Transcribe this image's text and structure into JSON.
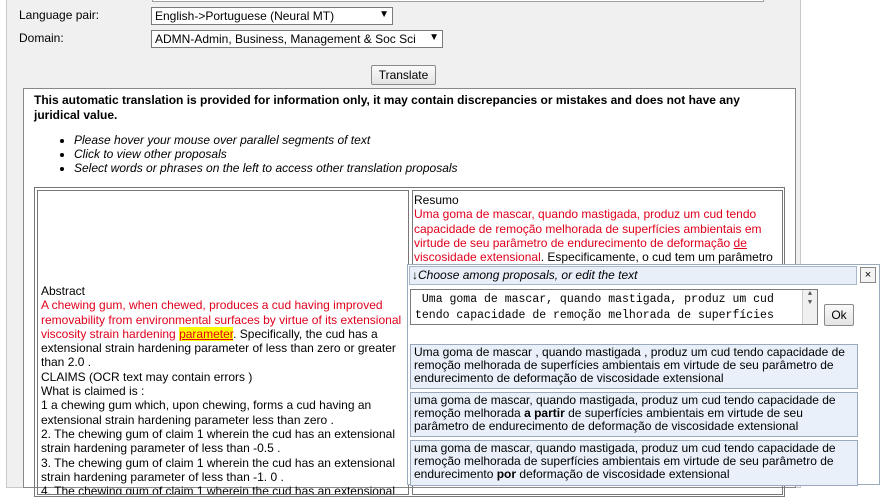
{
  "form": {
    "language_pair_label": "Language pair:",
    "language_pair_value": "English->Portuguese (Neural MT)",
    "domain_label": "Domain:",
    "domain_value": "ADMN-Admin, Business, Management & Soc Sci",
    "translate_button": "Translate"
  },
  "notice": "This automatic translation is provided for information only, it may contain discrepancies or mistakes and does not have any juridical value.",
  "hints": [
    "Please hover your mouse over parallel segments of text",
    "Click to view other proposals",
    "Select words or phrases on the left to access other translation proposals"
  ],
  "source": {
    "heading": "Abstract",
    "seg1_red": "A chewing gum, when chewed, produces a cud having improved removability from environmental surfaces by virtue of its extensional viscosity strain hardening ",
    "seg1_highlight": "parameter",
    "seg2": ". Specifically, the cud has a extensional strain hardening parameter of less than zero or greater than 2.0 .",
    "claims_heading": "CLAIMS (OCR text may contain errors )",
    "claims_intro": "What is claimed is :",
    "claim1": "1 a chewing gum which, upon chewing, forms a cud having an extensional strain hardening parameter less than zero .",
    "claim2": "2. The chewing gum of claim 1 wherein the cud has an extensional strain hardening parameter of less than -0.5 .",
    "claim3": "3. The chewing gum of claim 1 wherein the cud has an extensional strain hardening parameter of less than -1. 0 .",
    "claim4": "4. The chewing gum of claim 1 wherein the cud has an extensional"
  },
  "target": {
    "heading": "Resumo",
    "seg1_red": "Uma goma de mascar, quando mastigada, produz um cud tendo capacidade de remoção melhorada de superfícies ambientais em virtude de seu parâmetro de endurecimento de deformação ",
    "seg1_red_ul": "de",
    "seg1_red_end": "viscosidade extensional",
    "seg2": ". Especificamente, o cud tem um parâmetro"
  },
  "popup": {
    "header": "↓Choose among proposals, or edit the text",
    "close": "×",
    "edit_line1": " Uma goma de mascar, quando mastigada, produz um cud",
    "edit_line2": "tendo capacidade de remoção melhorada de superfícies",
    "ok_button": "Ok",
    "p1": "Uma goma de mascar , quando mastigada , produz um cud tendo capacidade de remoção melhorada de superfícies ambientais em virtude de seu parâmetro de endurecimento de deformação de viscosidade extensional",
    "p2_a": "uma goma de mascar, quando mastigada, produz um cud tendo capacidade de remoção melhorada ",
    "p2_b": "a partir",
    "p2_c": " de superfícies ambientais em virtude de seu parâmetro de endurecimento de deformação de viscosidade extensional",
    "p3_a": "uma goma de mascar, quando mastigada, produz um cud tendo capacidade de remoção melhorada de superfícies ambientais em virtude de seu parâmetro de endurecimento ",
    "p3_b": "por",
    "p3_c": " deformação de viscosidade extensional"
  }
}
